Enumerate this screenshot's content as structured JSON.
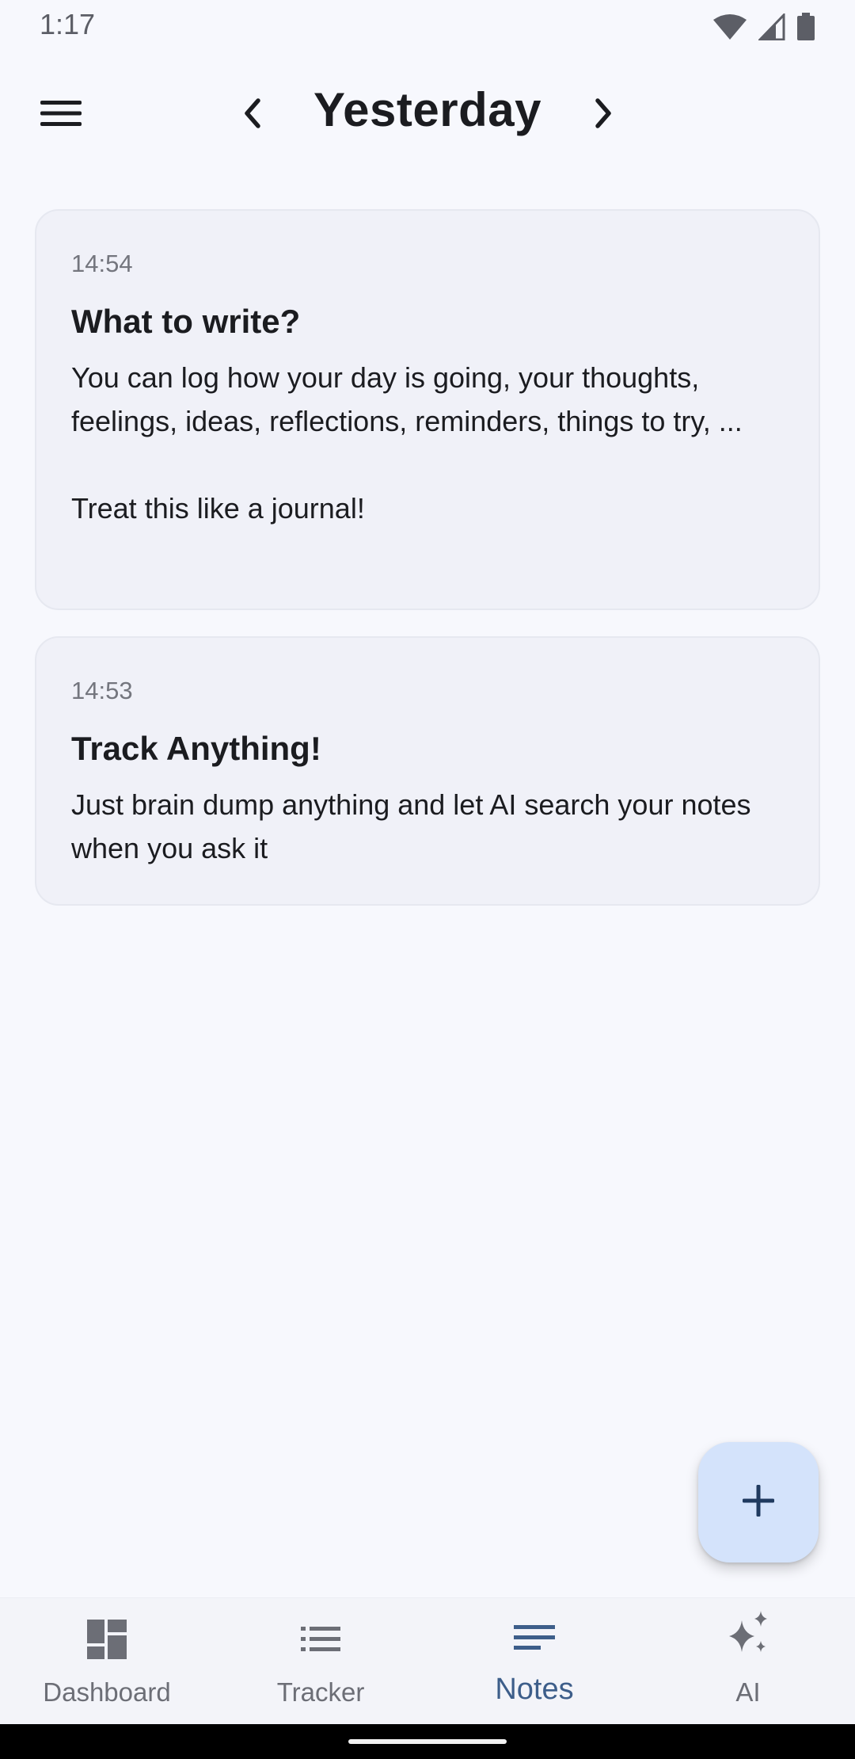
{
  "status_bar": {
    "time": "1:17",
    "icons": [
      "wifi-icon",
      "cellular-signal-icon",
      "battery-icon"
    ]
  },
  "header": {
    "menu_icon": "hamburger-menu-icon",
    "prev_icon": "chevron-left-icon",
    "title": "Yesterday",
    "next_icon": "chevron-right-icon"
  },
  "notes": [
    {
      "time": "14:54",
      "title": "What to write?",
      "body": "You can log how your day is going, your thoughts, feelings, ideas, reflections, reminders, things to try, ...\n\nTreat this like a journal!"
    },
    {
      "time": "14:53",
      "title": "Track Anything!",
      "body": "Just brain dump anything and let AI search your notes when you ask it"
    }
  ],
  "fab": {
    "icon": "plus-icon"
  },
  "bottom_nav": {
    "active": "Notes",
    "items": [
      {
        "label": "Dashboard",
        "icon": "dashboard-icon"
      },
      {
        "label": "Tracker",
        "icon": "list-icon"
      },
      {
        "label": "Notes",
        "icon": "notes-icon"
      },
      {
        "label": "AI",
        "icon": "sparkle-icon"
      }
    ]
  },
  "colors": {
    "background": "#f7f8fd",
    "card": "#f0f1f8",
    "accent": "#3d5e8a",
    "fab": "#d4e3fb"
  }
}
